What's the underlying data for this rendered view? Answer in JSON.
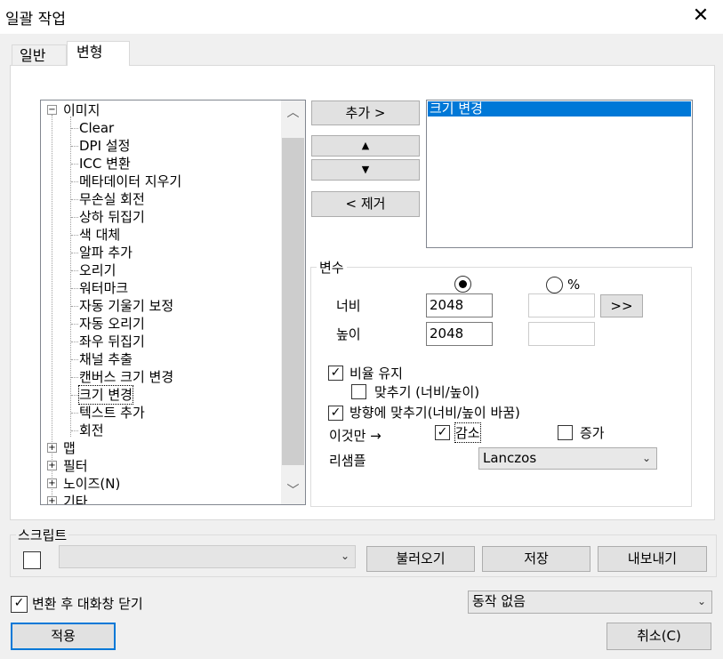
{
  "window": {
    "title": "일괄 작업",
    "close_glyph": "✕"
  },
  "tabs": [
    {
      "label": "일반",
      "active": false
    },
    {
      "label": "변형",
      "active": true
    }
  ],
  "tree": {
    "root_label": "이미지",
    "root_expander": "−",
    "children": [
      "Clear",
      "DPI 설정",
      "ICC 변환",
      "메타데이터 지우기",
      "무손실 회전",
      "상하 뒤집기",
      "색 대체",
      "알파 추가",
      "오리기",
      "워터마크",
      "자동 기울기 보정",
      "자동 오리기",
      "좌우 뒤집기",
      "채널 추출",
      "캔버스 크기 변경",
      "크기 변경",
      "텍스트 추가",
      "회전"
    ],
    "selected": "크기 변경",
    "other_roots": [
      "맵",
      "필터",
      "노이즈(N)",
      "기타"
    ],
    "other_expander": "+"
  },
  "scrollbar": {
    "up_glyph": "︿",
    "down_glyph": "﹀"
  },
  "buttons": {
    "add": "추가 >",
    "up": "▲",
    "down": "▼",
    "remove": "< 제거",
    "expand": ">>",
    "load": "불러오기",
    "save": "저장",
    "export": "내보내기",
    "apply": "적용",
    "cancel": "취소(C)"
  },
  "action_list": {
    "items": [
      "크기 변경"
    ]
  },
  "params": {
    "group_label": "변수",
    "percent_label": "%",
    "width_label": "너비",
    "width_value": "2048",
    "height_label": "높이",
    "height_value": "2048",
    "keep_ratio_label": "비율 유지",
    "keep_ratio_checked": true,
    "fit_label": "맞추기 (너비/높이)",
    "fit_checked": false,
    "fit_orient_label": "방향에 맞추기(너비/높이 바꿈)",
    "fit_orient_checked": true,
    "only_label": "이것만 →",
    "decrease_label": "감소",
    "decrease_checked": true,
    "increase_label": "증가",
    "increase_checked": false,
    "resample_label": "리샘플",
    "resample_value": "Lanczos",
    "check_glyph": "✓",
    "combo_arrow": "⌄"
  },
  "script": {
    "label": "스크립트",
    "checked": false,
    "value": ""
  },
  "footer": {
    "close_after_label": "변환 후 대화창 닫기",
    "close_after_checked": true,
    "action_value": "동작 없음"
  }
}
